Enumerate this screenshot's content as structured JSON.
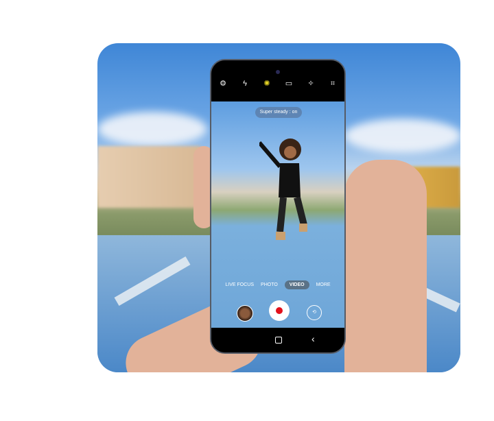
{
  "camera": {
    "top_icons": [
      {
        "name": "settings-icon",
        "glyph": "⚙",
        "active": false
      },
      {
        "name": "flash-off-icon",
        "glyph": "ϟ",
        "active": false
      },
      {
        "name": "super-steady-icon",
        "glyph": "✺",
        "active": true
      },
      {
        "name": "aspect-ratio-icon",
        "glyph": "▭",
        "active": false
      },
      {
        "name": "effects-icon",
        "glyph": "✧",
        "active": false
      },
      {
        "name": "focus-frame-icon",
        "glyph": "⌗",
        "active": false
      }
    ],
    "status_pill": "Super steady : on",
    "modes": [
      "LIVE FOCUS",
      "PHOTO",
      "VIDEO",
      "MORE"
    ],
    "selected_mode": "VIDEO",
    "record_color": "#e3101b",
    "accent_color": "#e4d326"
  }
}
